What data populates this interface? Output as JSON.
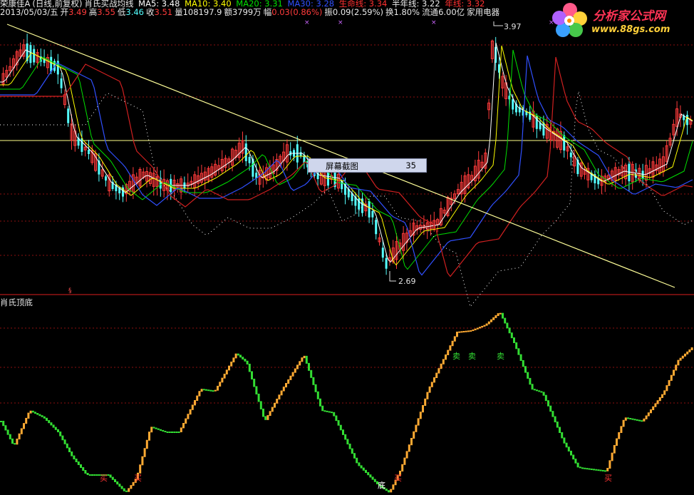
{
  "header": {
    "line1": {
      "stock": "荣康佳A",
      "period": "(日线,前复权)",
      "indicator": "肖氏买战均线",
      "ma5": "MA5: 3.48",
      "ma10": "MA10: 3.40",
      "ma20": "MA20: 3.31",
      "ma30": "MA30: 3.28",
      "life_line": "生命线: 3.34",
      "half_year": "半年线: 3.22",
      "year_line": "年线: 3.32"
    },
    "line2": {
      "date": "2013/05/03/五",
      "open_label": "开",
      "open": "3.49",
      "high_label": "高",
      "high": "3.55",
      "low_label": "低",
      "low": "3.46",
      "close_label": "收",
      "close": "3.51",
      "volume_label": "量",
      "volume": "108197.9",
      "amount_label": "额",
      "amount": "3799万",
      "change_label": "幅",
      "change": "0.03(0.86%)",
      "amplitude_label": "振",
      "amplitude": "0.09(2.59%)",
      "turnover_label": "换",
      "turnover": "1.80%",
      "float_label": "流通",
      "float": "6.00亿",
      "sector": "家用电器"
    }
  },
  "logo": {
    "title": "分析家公式网",
    "url": "www.88gs.com"
  },
  "price_annotations": {
    "high_mark": "3.97",
    "low_mark": "2.69"
  },
  "tooltip": {
    "label": "屏幕截图",
    "value": "35"
  },
  "sub_indicator": {
    "title": "肖氏顶底"
  },
  "signals": {
    "sell": "卖",
    "buy": "买",
    "bottom": "底"
  },
  "colors": {
    "bg": "#000000",
    "up": "#ff3b3b",
    "down": "#54ffff",
    "ma5": "#ffffff",
    "ma10": "#ffff00",
    "ma20": "#00e000",
    "ma30": "#3050ff",
    "life": "#d02020",
    "trendline": "#ffff99",
    "osc_up": "#ffaa33",
    "osc_down": "#33dd33",
    "grid": "#8b1010"
  }
}
